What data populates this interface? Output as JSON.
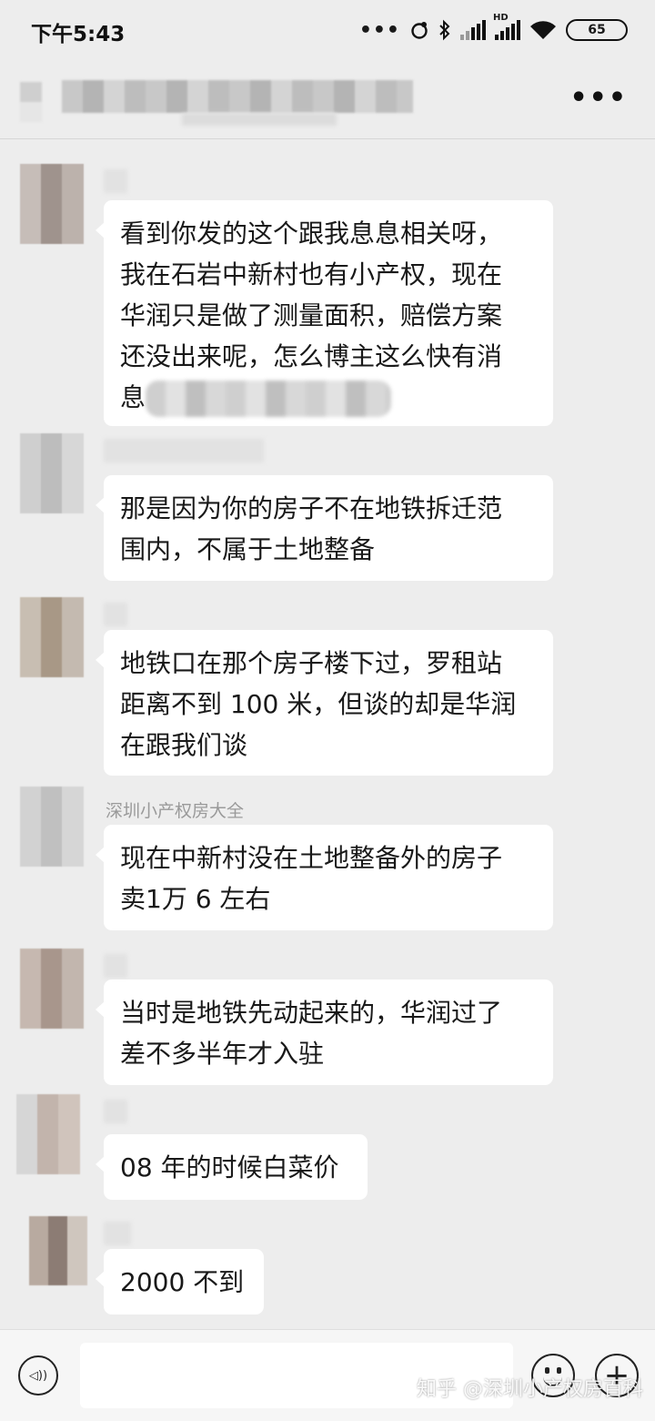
{
  "status_bar": {
    "time": "下午5:43",
    "battery": "65",
    "icons": [
      "more-dots-icon",
      "alarm-icon",
      "bluetooth-icon",
      "signal-icon",
      "hd-signal-icon",
      "wifi-icon",
      "battery-icon"
    ],
    "hd_label": "HD"
  },
  "header": {
    "more_label": "•••"
  },
  "messages": [
    {
      "nick": "",
      "lines": [
        "看到你发的这个跟我息息相关呀，",
        "我在石岩中新村也有小产权，现在",
        "华润只是做了测量面积，赔偿方案",
        "还没出来呢，怎么博主这么快有消"
      ],
      "last_prefix": "息"
    },
    {
      "nick": "",
      "lines": [
        "那是因为你的房子不在地铁拆迁范",
        "围内，不属于土地整备"
      ]
    },
    {
      "nick": "",
      "lines": [
        "地铁口在那个房子楼下过，罗租站",
        "距离不到 100 米，但谈的却是华润",
        "在跟我们谈"
      ]
    },
    {
      "nick": "深圳小产权房大全",
      "lines": [
        "现在中新村没在土地整备外的房子",
        "卖1万 6 左右"
      ]
    },
    {
      "nick": "",
      "lines": [
        "当时是地铁先动起来的，华润过了",
        "差不多半年才入驻"
      ]
    },
    {
      "nick": "",
      "lines": [
        "08 年的时候白菜价"
      ]
    },
    {
      "nick": "",
      "lines": [
        "2000 不到"
      ]
    }
  ],
  "input_bar": {
    "voice_icon": "voice-icon",
    "emoji_icon": "emoji-icon",
    "plus_icon": "plus-icon",
    "plus_label": "+",
    "voice_label": "◁))"
  },
  "watermark": "知乎 @深圳小产权房百科",
  "colors": {
    "background": "#ededed",
    "bubble": "#ffffff",
    "text": "#191919",
    "nickname": "#9a9a9a"
  }
}
